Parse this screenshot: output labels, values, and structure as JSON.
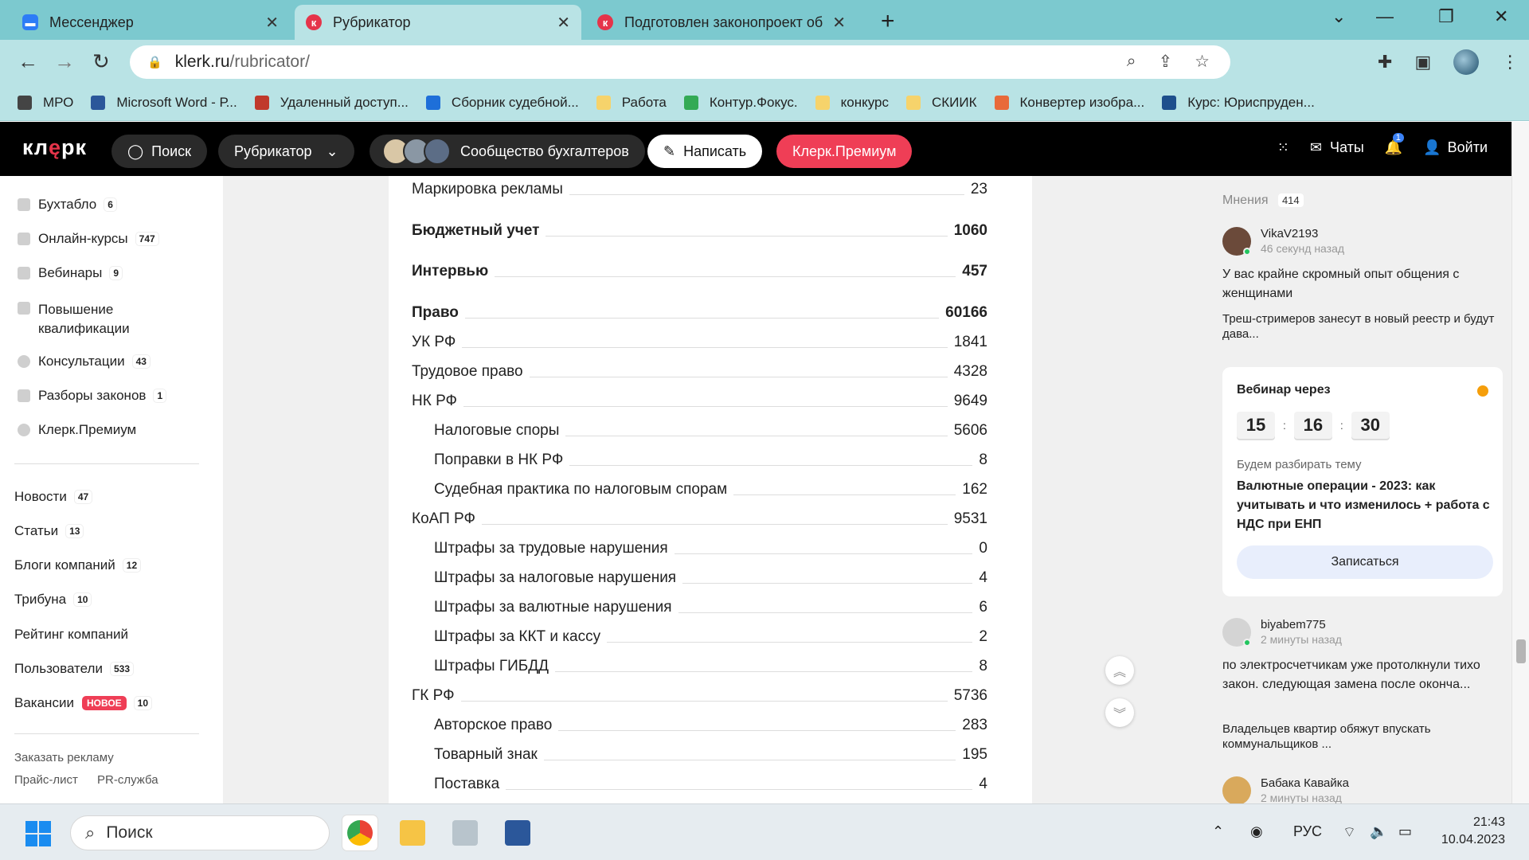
{
  "browser": {
    "tabs": [
      {
        "label": "Мессенджер"
      },
      {
        "label": "Рубрикатор"
      },
      {
        "label": "Подготовлен законопроект об о"
      }
    ],
    "url_host": "klerk.ru",
    "url_path": "/rubricator/",
    "bookmarks": [
      {
        "label": "МРО",
        "color": "#444444"
      },
      {
        "label": "Microsoft Word - Р...",
        "color": "#2b579a"
      },
      {
        "label": "Удаленный доступ...",
        "color": "#c0392b"
      },
      {
        "label": "Сборник судебной...",
        "color": "#1e6fd9"
      },
      {
        "label": "Работа",
        "color": "#f6d36b"
      },
      {
        "label": "Контур.Фокус.",
        "color": "#33aa55"
      },
      {
        "label": "конкурс",
        "color": "#f6d36b"
      },
      {
        "label": "СКИИК",
        "color": "#f6d36b"
      },
      {
        "label": "Конвертер изобра...",
        "color": "#e86a3a"
      },
      {
        "label": "Курс: Юриспруден...",
        "color": "#1e4f8c"
      }
    ]
  },
  "site": {
    "logo": "клерк",
    "search": "Поиск",
    "rubricator": "Рубрикатор",
    "community": "Сообщество бухгалтеров",
    "write": "Написать",
    "premium": "Клерк.Премиум",
    "chats": "Чаты",
    "notif_count": "1",
    "login": "Войти",
    "accent": "#ef3e56"
  },
  "sidebar": {
    "top_items": [
      {
        "label": "Бухтабло",
        "count": "6"
      },
      {
        "label": "Онлайн-курсы",
        "count": "747"
      },
      {
        "label": "Вебинары",
        "count": "9"
      },
      {
        "label": "Повышение квалификации",
        "count": ""
      },
      {
        "label": "Консультации",
        "count": "43"
      },
      {
        "label": "Разборы законов",
        "count": "1"
      },
      {
        "label": "Клерк.Премиум",
        "count": ""
      }
    ],
    "nav_items": [
      {
        "label": "Новости",
        "count": "47"
      },
      {
        "label": "Статьи",
        "count": "13"
      },
      {
        "label": "Блоги компаний",
        "count": "12"
      },
      {
        "label": "Трибуна",
        "count": "10"
      },
      {
        "label": "Рейтинг компаний",
        "count": ""
      },
      {
        "label": "Пользователи",
        "count": "533"
      },
      {
        "label": "Вакансии",
        "count": "10",
        "badge": "НОВОЕ"
      }
    ],
    "footer": [
      "Заказать рекламу",
      "Прайс-лист",
      "PR-служба"
    ]
  },
  "rubrics": [
    {
      "label": "Маркировка рекламы",
      "count": "23",
      "level": 0,
      "bold": false
    },
    {
      "label": "Бюджетный учет",
      "count": "1060",
      "level": 0,
      "bold": true
    },
    {
      "label": "Интервью",
      "count": "457",
      "level": 0,
      "bold": true
    },
    {
      "label": "Право",
      "count": "60166",
      "level": 0,
      "bold": true
    },
    {
      "label": "УК РФ",
      "count": "1841",
      "level": 0,
      "bold": false
    },
    {
      "label": "Трудовое право",
      "count": "4328",
      "level": 0,
      "bold": false
    },
    {
      "label": "НК РФ",
      "count": "9649",
      "level": 0,
      "bold": false
    },
    {
      "label": "Налоговые споры",
      "count": "5606",
      "level": 1,
      "bold": false
    },
    {
      "label": "Поправки в НК РФ",
      "count": "8",
      "level": 1,
      "bold": false
    },
    {
      "label": "Судебная практика по налоговым спорам",
      "count": "162",
      "level": 1,
      "bold": false
    },
    {
      "label": "КоАП РФ",
      "count": "9531",
      "level": 0,
      "bold": false
    },
    {
      "label": "Штрафы за трудовые нарушения",
      "count": "0",
      "level": 1,
      "bold": false
    },
    {
      "label": "Штрафы за налоговые нарушения",
      "count": "4",
      "level": 1,
      "bold": false
    },
    {
      "label": "Штрафы за валютные нарушения",
      "count": "6",
      "level": 1,
      "bold": false
    },
    {
      "label": "Штрафы за ККТ и кассу",
      "count": "2",
      "level": 1,
      "bold": false
    },
    {
      "label": "Штрафы ГИБДД",
      "count": "8",
      "level": 1,
      "bold": false
    },
    {
      "label": "ГК РФ",
      "count": "5736",
      "level": 0,
      "bold": false
    },
    {
      "label": "Авторское право",
      "count": "283",
      "level": 1,
      "bold": false
    },
    {
      "label": "Товарный знак",
      "count": "195",
      "level": 1,
      "bold": false
    },
    {
      "label": "Поставка",
      "count": "4",
      "level": 1,
      "bold": false
    }
  ],
  "opinions": {
    "title": "Мнения",
    "count": "414",
    "items": [
      {
        "user": "VikaV2193",
        "time": "46 секунд назад",
        "text": "У вас крайне скромный опыт общения с женщинами",
        "article": "Треш-стримеров занесут в новый реестр и будут дава..."
      },
      {
        "user": "biyabem775",
        "time": "2 минуты назад",
        "text": "по электросчетчикам уже протолкнули тихо закон. следующая замена после оконча...",
        "article": "Владельцев квартир обяжут впускать коммунальщиков ..."
      },
      {
        "user": "Бабака Кавайка",
        "time": "2 минуты назад",
        "text": "",
        "article": ""
      }
    ]
  },
  "webinar": {
    "title": "Вебинар через",
    "hours": "15",
    "minutes": "16",
    "seconds": "30",
    "subtitle": "Будем разбирать тему",
    "topic": "Валютные операции - 2023: как учитывать и что изменилось + работа с НДС при ЕНП",
    "button": "Записаться"
  },
  "taskbar": {
    "search": "Поиск",
    "lang": "РУС",
    "time": "21:43",
    "date": "10.04.2023"
  }
}
